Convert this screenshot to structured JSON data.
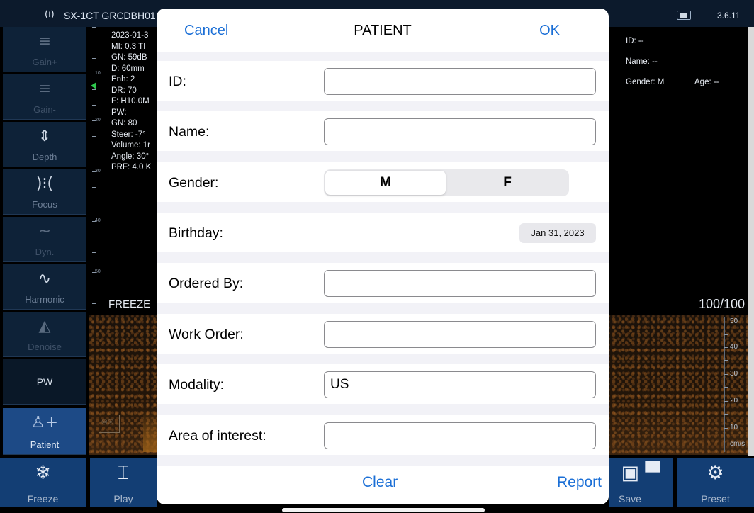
{
  "status_bar": {
    "wifi_icon": "wifi-icon",
    "device_name": "SX-1CT GRCDBH01",
    "version": "3.6.11"
  },
  "left_tools": [
    {
      "label": "Gain+",
      "icon": "≡"
    },
    {
      "label": "Gain-",
      "icon": "≡"
    },
    {
      "label": "Depth",
      "icon": "⇕"
    },
    {
      "label": "Focus",
      "icon": ")⁝("
    },
    {
      "label": "Dyn.",
      "icon": "∼"
    },
    {
      "label": "Harmonic",
      "icon": "∿"
    },
    {
      "label": "Denoise",
      "icon": "◭"
    },
    {
      "label": "PW",
      "icon": ""
    },
    {
      "label": "Patient",
      "icon": "♙+"
    }
  ],
  "image_params": [
    "2023-01-3",
    "MI: 0.3  TI",
    "GN: 59dB",
    "D: 60mm",
    "Enh: 2",
    "DR: 70",
    "F: H10.0M",
    "PW:",
    "GN: 80",
    "Steer: -7°",
    "Volume: 1r",
    "Angle: 30°",
    "PRF: 4.0 K"
  ],
  "depth_scale": [
    "10",
    "20",
    "30",
    "40",
    "50"
  ],
  "freeze_label": "FREEZE",
  "patient_info": {
    "id": "ID: --",
    "name": "Name: --",
    "gender": "Gender: M",
    "age": "Age: --"
  },
  "ratio": "100/100",
  "velocity_scale": [
    "50",
    "40",
    "30",
    "20",
    "10"
  ],
  "velocity_unit": "cm/s",
  "bottom_buttons": {
    "freeze": "Freeze",
    "play": "Play",
    "save": "Save",
    "preset": "Preset"
  },
  "modal": {
    "cancel": "Cancel",
    "title": "PATIENT",
    "ok": "OK",
    "fields": {
      "id_label": "ID:",
      "id_value": "",
      "name_label": "Name:",
      "name_value": "",
      "gender_label": "Gender:",
      "gender_m": "M",
      "gender_f": "F",
      "birthday_label": "Birthday:",
      "birthday_value": "Jan 31, 2023",
      "ordered_by_label": "Ordered By:",
      "ordered_by_value": "",
      "work_order_label": "Work Order:",
      "work_order_value": "",
      "modality_label": "Modality:",
      "modality_value": "US",
      "area_label": "Area of interest:",
      "area_value": ""
    },
    "clear": "Clear",
    "report": "Report"
  }
}
